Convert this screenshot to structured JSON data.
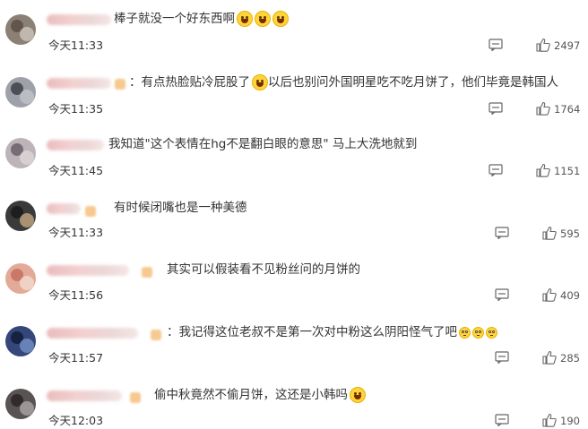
{
  "comments": [
    {
      "text": "棒子就没一个好东西啊",
      "emoji_count": 3,
      "time": "今天11:33",
      "likes": "2497",
      "avatar_colors": [
        "#6b5f55",
        "#c9c3bb"
      ]
    },
    {
      "text": "：有点热脸贴冷屁股了",
      "text_after": "以后也别问外国明星吃不吃月饼了，他们毕竟是韩国人",
      "time": "今天11:35",
      "likes": "1764",
      "avatar_colors": [
        "#8a8d98",
        "#3d3f4a"
      ]
    },
    {
      "text": "我知道\"这个表情在hg不是翻白眼的意思\" 马上大洗地就到",
      "time": "今天11:45",
      "likes": "1151",
      "avatar_colors": [
        "#b9b0b5",
        "#726870"
      ]
    },
    {
      "text": "有时候闭嘴也是一种美德",
      "time": "今天11:33",
      "likes": "595",
      "avatar_colors": [
        "#2b2b2b",
        "#d9b88c"
      ]
    },
    {
      "text": "其实可以假装看不见粉丝问的月饼的",
      "time": "今天11:56",
      "likes": "409",
      "avatar_colors": [
        "#d98f7e",
        "#f0d7c8"
      ]
    },
    {
      "text": "：我记得这位老叔不是第一次对中粉这么阴阳怪气了吧",
      "emoji_count": 3,
      "time": "今天11:57",
      "likes": "285",
      "avatar_colors": [
        "#1f2e52",
        "#5d7cb0"
      ]
    },
    {
      "text": "偷中秋竟然不偷月饼，这还是小韩吗",
      "emoji_count": 1,
      "time": "今天12:03",
      "likes": "190",
      "avatar_colors": [
        "#3b3637",
        "#a09a98"
      ]
    }
  ],
  "icons": {
    "reply": "comment-reply-icon",
    "like": "thumbs-up-icon"
  }
}
